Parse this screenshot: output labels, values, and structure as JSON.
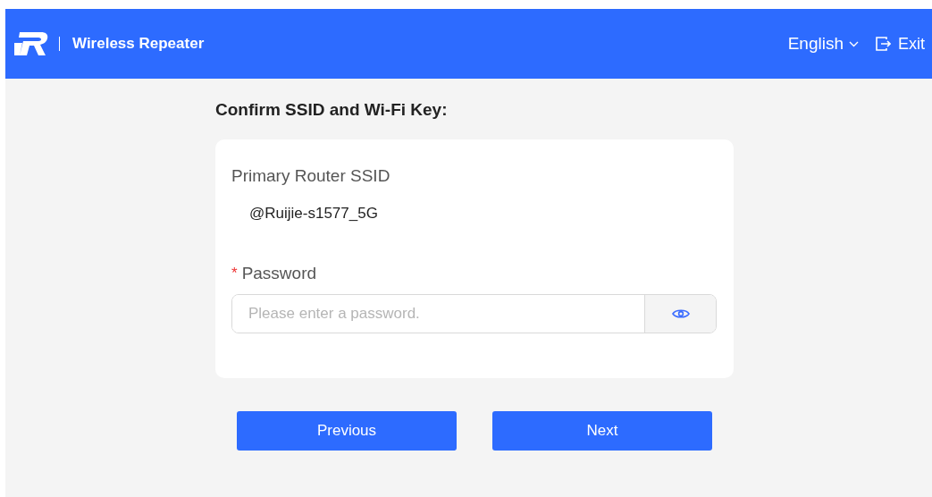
{
  "header": {
    "title": "Wireless Repeater",
    "language": "English",
    "exit": "Exit"
  },
  "form": {
    "heading": "Confirm SSID and Wi-Fi Key:",
    "ssid": {
      "label": "Primary Router SSID",
      "value": "@Ruijie-s1577_5G"
    },
    "password": {
      "label": "Password",
      "required": true,
      "required_mark": "*",
      "placeholder": "Please enter a password."
    }
  },
  "buttons": [
    {
      "label": "Previous"
    },
    {
      "label": "Next"
    }
  ]
}
